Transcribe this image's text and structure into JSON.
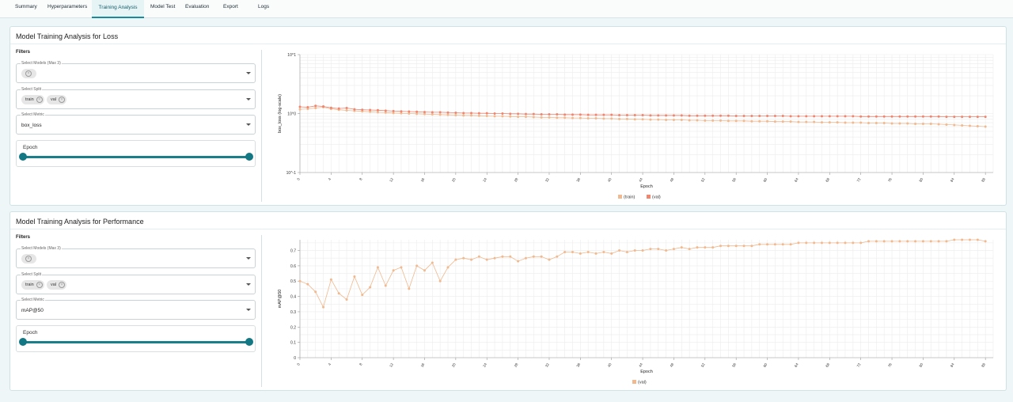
{
  "tabs": [
    {
      "label": "Summary",
      "active": false
    },
    {
      "label": "Hyperparameters",
      "active": false
    },
    {
      "label": "Training Analysis",
      "active": true
    },
    {
      "label": "Model Test",
      "active": false
    },
    {
      "label": "Evaluation",
      "active": false
    },
    {
      "label": "Export",
      "active": false
    },
    {
      "label": "Logs",
      "active": false
    }
  ],
  "colors": {
    "accent": "#1a7f8a",
    "train": "#f0b98f",
    "val": "#ee8670"
  },
  "loss_panel": {
    "title": "Model Training Analysis for Loss",
    "filters_label": "Filters",
    "models_label": "Select Models (Max 3)",
    "split_label": "Select Split",
    "split_chips": [
      "train",
      "val"
    ],
    "metric_label": "Select Metric",
    "metric_value": "box_loss",
    "epoch_label": "Epoch",
    "epoch_range": [
      0,
      1
    ]
  },
  "perf_panel": {
    "title": "Model Training Analysis for Performance",
    "filters_label": "Filters",
    "models_label": "Select Models (Max 3)",
    "split_label": "Select Split",
    "split_chips": [
      "train",
      "val"
    ],
    "metric_label": "Select Metric",
    "metric_value": "mAP@50",
    "epoch_label": "Epoch",
    "epoch_range": [
      0,
      1
    ]
  },
  "chart_data": [
    {
      "type": "line",
      "xlabel": "Epoch",
      "ylabel": "box_loss (log-scale)",
      "yscale": "log",
      "ylim": [
        0.1,
        10
      ],
      "yticks": [
        "10^-1",
        "10^0",
        "10^1"
      ],
      "xlim": [
        0,
        89
      ],
      "xticks": [
        0,
        4,
        8,
        12,
        16,
        20,
        24,
        28,
        32,
        36,
        40,
        44,
        48,
        52,
        56,
        60,
        64,
        68,
        72,
        76,
        80,
        84,
        88
      ],
      "grid": true,
      "legend_position": "bottom",
      "series": [
        {
          "name": "(train)",
          "color": "#f0b98f",
          "values": [
            1.18,
            1.2,
            1.24,
            1.28,
            1.2,
            1.16,
            1.13,
            1.11,
            1.09,
            1.07,
            1.05,
            1.04,
            1.02,
            1.01,
            1.0,
            0.99,
            0.98,
            0.97,
            0.96,
            0.95,
            0.94,
            0.93,
            0.93,
            0.92,
            0.91,
            0.9,
            0.9,
            0.89,
            0.88,
            0.88,
            0.87,
            0.86,
            0.86,
            0.85,
            0.85,
            0.84,
            0.84,
            0.83,
            0.83,
            0.82,
            0.82,
            0.81,
            0.81,
            0.8,
            0.8,
            0.79,
            0.79,
            0.78,
            0.78,
            0.78,
            0.77,
            0.77,
            0.76,
            0.76,
            0.76,
            0.75,
            0.75,
            0.75,
            0.74,
            0.74,
            0.74,
            0.73,
            0.73,
            0.73,
            0.72,
            0.72,
            0.72,
            0.71,
            0.71,
            0.71,
            0.7,
            0.7,
            0.7,
            0.69,
            0.69,
            0.69,
            0.68,
            0.68,
            0.68,
            0.67,
            0.67,
            0.67,
            0.66,
            0.65,
            0.64,
            0.63,
            0.62,
            0.61,
            0.6
          ]
        },
        {
          "name": "(val)",
          "color": "#ee8670",
          "values": [
            1.3,
            1.28,
            1.35,
            1.32,
            1.25,
            1.22,
            1.24,
            1.18,
            1.16,
            1.15,
            1.14,
            1.12,
            1.1,
            1.09,
            1.08,
            1.07,
            1.06,
            1.05,
            1.05,
            1.04,
            1.03,
            1.02,
            1.02,
            1.01,
            1.01,
            1.0,
            1.0,
            0.99,
            0.99,
            0.98,
            0.98,
            0.97,
            0.97,
            0.97,
            0.96,
            0.96,
            0.96,
            0.95,
            0.95,
            0.95,
            0.95,
            0.94,
            0.94,
            0.94,
            0.94,
            0.93,
            0.93,
            0.93,
            0.93,
            0.93,
            0.92,
            0.92,
            0.92,
            0.92,
            0.92,
            0.92,
            0.91,
            0.91,
            0.91,
            0.91,
            0.91,
            0.91,
            0.91,
            0.9,
            0.9,
            0.9,
            0.9,
            0.9,
            0.9,
            0.9,
            0.9,
            0.9,
            0.89,
            0.89,
            0.89,
            0.89,
            0.89,
            0.89,
            0.89,
            0.89,
            0.89,
            0.89,
            0.89,
            0.88,
            0.88,
            0.88,
            0.88,
            0.88,
            0.88
          ]
        }
      ]
    },
    {
      "type": "line",
      "xlabel": "Epoch",
      "ylabel": "mAP@50",
      "ylim": [
        0,
        0.77
      ],
      "yticks": [
        "0",
        "0.1",
        "0.2",
        "0.3",
        "0.4",
        "0.5",
        "0.6",
        "0.7"
      ],
      "xlim": [
        0,
        89
      ],
      "xticks": [
        0,
        4,
        8,
        12,
        16,
        20,
        24,
        28,
        32,
        36,
        40,
        44,
        48,
        52,
        56,
        60,
        64,
        68,
        72,
        76,
        80,
        84,
        88
      ],
      "grid": true,
      "legend_position": "bottom",
      "series": [
        {
          "name": "(val)",
          "color": "#f0b98f",
          "values": [
            0.5,
            0.48,
            0.43,
            0.33,
            0.51,
            0.42,
            0.38,
            0.53,
            0.41,
            0.46,
            0.59,
            0.47,
            0.57,
            0.59,
            0.45,
            0.6,
            0.57,
            0.62,
            0.5,
            0.59,
            0.64,
            0.65,
            0.64,
            0.66,
            0.64,
            0.65,
            0.66,
            0.66,
            0.63,
            0.65,
            0.66,
            0.66,
            0.64,
            0.66,
            0.69,
            0.69,
            0.68,
            0.69,
            0.68,
            0.69,
            0.68,
            0.7,
            0.69,
            0.7,
            0.7,
            0.71,
            0.71,
            0.7,
            0.71,
            0.72,
            0.71,
            0.72,
            0.72,
            0.72,
            0.73,
            0.73,
            0.73,
            0.73,
            0.73,
            0.74,
            0.74,
            0.74,
            0.74,
            0.74,
            0.75,
            0.75,
            0.75,
            0.75,
            0.75,
            0.75,
            0.75,
            0.75,
            0.75,
            0.76,
            0.76,
            0.76,
            0.76,
            0.76,
            0.76,
            0.76,
            0.76,
            0.76,
            0.76,
            0.76,
            0.77,
            0.77,
            0.77,
            0.77,
            0.76
          ]
        }
      ]
    }
  ]
}
